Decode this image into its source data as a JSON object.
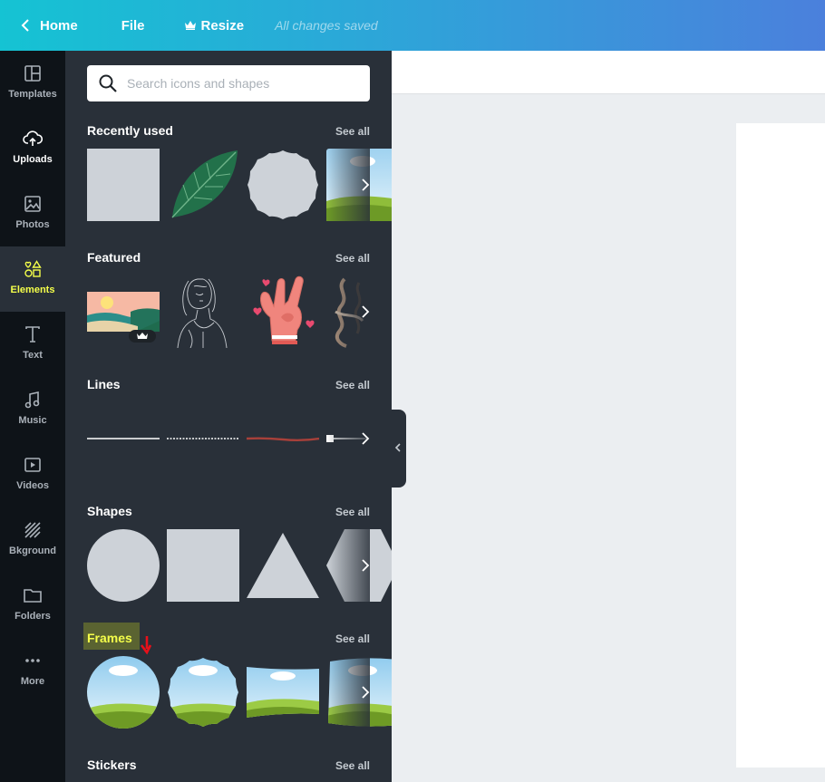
{
  "topbar": {
    "home_label": "Home",
    "file_label": "File",
    "resize_label": "Resize",
    "saved_status": "All changes saved"
  },
  "rail": {
    "items": [
      {
        "label": "Templates",
        "icon": "templates-icon"
      },
      {
        "label": "Uploads",
        "icon": "upload-cloud-icon"
      },
      {
        "label": "Photos",
        "icon": "photo-icon"
      },
      {
        "label": "Elements",
        "icon": "shapes-icon"
      },
      {
        "label": "Text",
        "icon": "text-icon"
      },
      {
        "label": "Music",
        "icon": "music-note-icon"
      },
      {
        "label": "Videos",
        "icon": "video-icon"
      },
      {
        "label": "Bkground",
        "icon": "background-pattern-icon"
      },
      {
        "label": "Folders",
        "icon": "folder-icon"
      },
      {
        "label": "More",
        "icon": "more-dots-icon"
      }
    ],
    "active": "Elements"
  },
  "panel": {
    "search_placeholder": "Search icons and shapes",
    "see_all": "See all",
    "sections": {
      "recently_used": "Recently used",
      "featured": "Featured",
      "lines": "Lines",
      "shapes": "Shapes",
      "frames": "Frames",
      "stickers": "Stickers"
    }
  },
  "colors": {
    "panel_bg": "#293039",
    "rail_bg": "#0e1318",
    "highlight": "#f5ff4a",
    "shape_fill": "#cdd2d8"
  }
}
